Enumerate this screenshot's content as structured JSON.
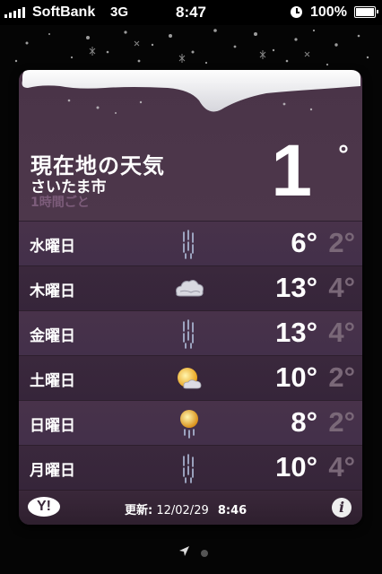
{
  "status_bar": {
    "carrier": "SoftBank",
    "network": "3G",
    "time": "8:47",
    "battery": "100%",
    "icons": [
      "signal-icon",
      "clock-icon",
      "battery-icon"
    ]
  },
  "location": {
    "title": "現在地の天気",
    "city": "さいたま市",
    "hourly_link": "1時間ごと",
    "current_temp": "1",
    "degree": "°"
  },
  "forecast": [
    {
      "day": "水曜日",
      "icon": "rain-icon",
      "high": "6°",
      "low": "2°"
    },
    {
      "day": "木曜日",
      "icon": "cloudy-icon",
      "high": "13°",
      "low": "4°"
    },
    {
      "day": "金曜日",
      "icon": "rain-icon",
      "high": "13°",
      "low": "4°"
    },
    {
      "day": "土曜日",
      "icon": "partly-sunny-icon",
      "high": "10°",
      "low": "2°"
    },
    {
      "day": "日曜日",
      "icon": "sun-rain-icon",
      "high": "8°",
      "low": "2°"
    },
    {
      "day": "月曜日",
      "icon": "rain-icon",
      "high": "10°",
      "low": "4°"
    }
  ],
  "footer": {
    "yahoo_logo": "Y!",
    "updated_label": "更新:",
    "updated_date": "12/02/29",
    "updated_time": "8:46",
    "info_icon": "i"
  },
  "pager": {
    "pages": 2,
    "current": 1
  },
  "colors": {
    "card_bg": "#3c2a3c",
    "low_temp": "#7a6878",
    "hourly": "#7c5c7a"
  }
}
